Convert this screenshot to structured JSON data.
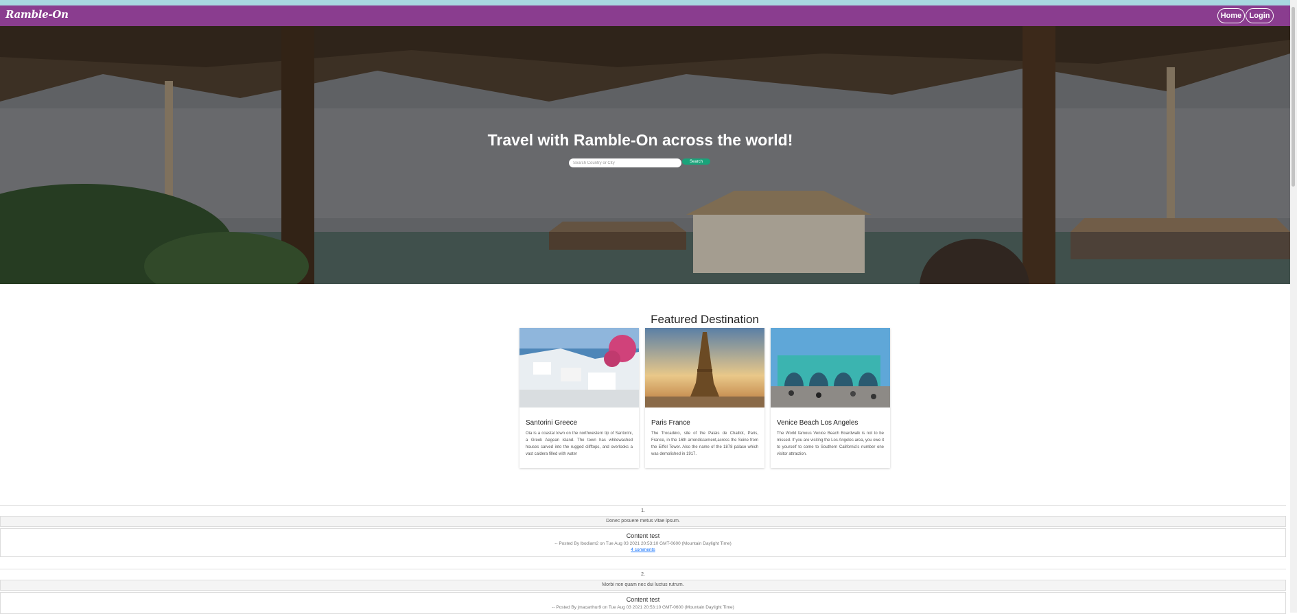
{
  "nav": {
    "brand": "Ramble-On",
    "home_label": "Home",
    "login_label": "Login",
    "color": "#8a3d8f"
  },
  "hero": {
    "title": "Travel with Ramble-On across the world!",
    "search_placeholder": "Search Country or City",
    "search_label": "Search",
    "search_color": "#1aa37a"
  },
  "featured": {
    "title": "Featured Destination",
    "cards": [
      {
        "title": "Santorini Greece",
        "text": "Oia is a coastal town on the northwestern tip of Santorini, a Greek Aegean island. The town has whitewashed houses carved into the rugged clifftops, and overlooks a vast caldera filled with water"
      },
      {
        "title": "Paris France",
        "text": "The Trocadéro, site of the Palais de Chaillot, Paris, France, in the 16th arrondissement,across the Seine from the Eiffel Tower. Also the name of the 1878 palace which was demolished in 1917."
      },
      {
        "title": "Venice Beach Los Angeles",
        "text": "The World famous Venice Beach Boardwalk is not to be missed. If you are visiting the Los Angeles area, you owe it to yourself to come to Southern California's number one visitor attraction."
      }
    ]
  },
  "posts": [
    {
      "number": "1.",
      "title": "Donec posuere metus vitae ipsum.",
      "content": "Content test",
      "meta": "-- Posted By lbodiam2 on Tue Aug 03 2021 20:53:10 GMT-0600 (Mountain Daylight Time)",
      "comments": "4 comments"
    },
    {
      "number": "2.",
      "title": "Morbi non quam nec dui luctus rutrum.",
      "content": "Content test",
      "meta": "-- Posted By jmacarthur9 on Tue Aug 03 2021 20:53:10 GMT-0600 (Mountain Daylight Time)"
    }
  ]
}
